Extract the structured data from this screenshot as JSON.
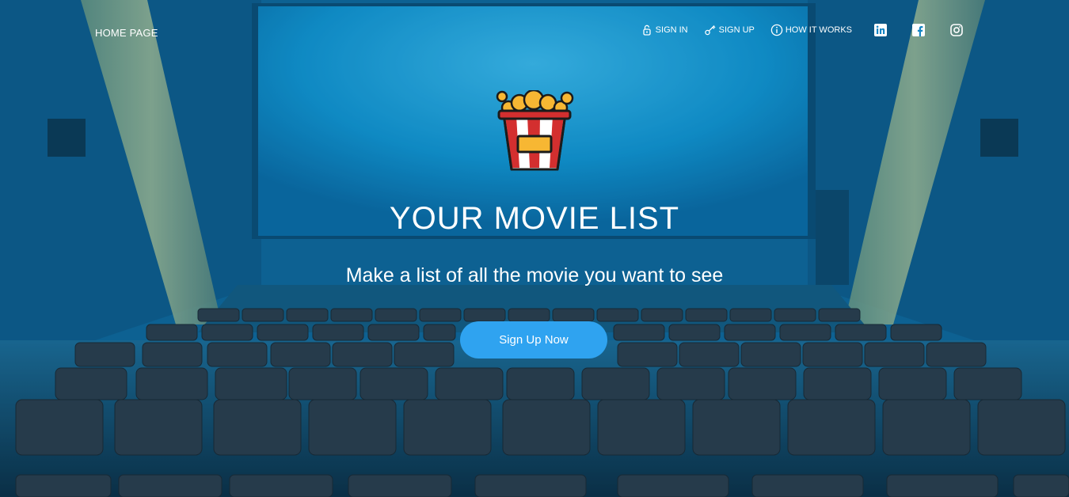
{
  "nav": {
    "home_label": "HOME PAGE",
    "links": [
      {
        "label": "SIGN IN",
        "icon": "lock-icon"
      },
      {
        "label": "SIGN UP",
        "icon": "key-icon"
      },
      {
        "label": "HOW IT WORKS",
        "icon": "info-icon"
      }
    ],
    "social": [
      "linkedin-icon",
      "facebook-icon",
      "instagram-icon"
    ]
  },
  "hero": {
    "title": "YOUR MOVIE LIST",
    "subtitle": "Make a list of all the movie you want to see",
    "cta_label": "Sign Up Now",
    "logo_icon": "popcorn-icon"
  },
  "colors": {
    "cta": "#2fa3f0",
    "screen": "#2aa8e6",
    "seats": "#2c3e4c",
    "wall": "#0c5f93"
  }
}
